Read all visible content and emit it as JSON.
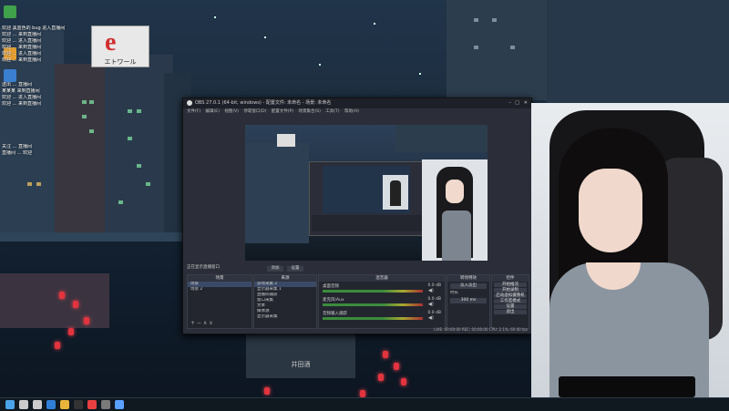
{
  "wallpaper": {
    "sign_glyph": "e",
    "sign_text": "エトワール",
    "shop_text": "井田酒"
  },
  "chat": {
    "messages": [
      "欢迎 黑蓝色的 bug 进入直播间",
      "欢迎 ... 来到直播间",
      "欢迎 ... 进入直播间",
      "欢迎 ... 来到直播间",
      "欢迎 ... 进入直播间",
      "欢迎 ... 来到直播间",
      "送出 ... 直播间",
      "某某某 来到直播间",
      "欢迎 ... 进入直播间",
      "欢迎 ... 来到直播间",
      "关注 ... 直播间",
      "直播间 ... 欢迎"
    ]
  },
  "obs": {
    "title": "OBS 27.0.1 (64-bit, windows) - 配置文件: 未命名 - 场景: 未命名",
    "menu": [
      "文件(F)",
      "编辑(E)",
      "视图(V)",
      "停靠窗口(D)",
      "配置文件(P)",
      "场景集合(S)",
      "工具(T)",
      "帮助(H)"
    ],
    "status_label": "正在显示直播窗口",
    "preview_chips": [
      "添加",
      "设置"
    ],
    "panels": {
      "scenes": {
        "header": "场景",
        "items": [
          "场景",
          "场景 2"
        ]
      },
      "sources": {
        "header": "来源",
        "items": [
          "游戏采集 2",
          "显示器采集 1",
          "直播间捕获",
          "窗口采集",
          "文本",
          "媒体源",
          "显示器采集"
        ]
      },
      "mixer": {
        "header": "混音器",
        "channels": [
          "桌面音频",
          "麦克风/Aux",
          "音频输入捕获"
        ],
        "db_values": [
          "0.0 dB",
          "0.0 dB",
          "0.0 dB"
        ]
      },
      "transitions": {
        "header": "转场特效",
        "type": "淡入淡出",
        "duration_label": "时长",
        "duration": "300 ms"
      },
      "controls": {
        "header": "控件",
        "buttons": [
          "开始推流",
          "开始录制",
          "启动虚拟摄像机",
          "工作室模式",
          "设置",
          "退出"
        ]
      }
    },
    "statusbar": "LIVE: 00:00:00  REC: 00:00:00  CPU: 2.1%, 60.00 fps"
  },
  "taskbar": {
    "apps": [
      "start",
      "search",
      "task-view",
      "edge",
      "explorer",
      "obs",
      "steam",
      "settings",
      "store"
    ],
    "app_colors": [
      "#4aa3e8",
      "#cccccc",
      "#cccccc",
      "#2f7fd6",
      "#e8b43a",
      "#333333",
      "#e84040",
      "#7a7a7a",
      "#5aa0ff"
    ]
  },
  "webcam": {}
}
